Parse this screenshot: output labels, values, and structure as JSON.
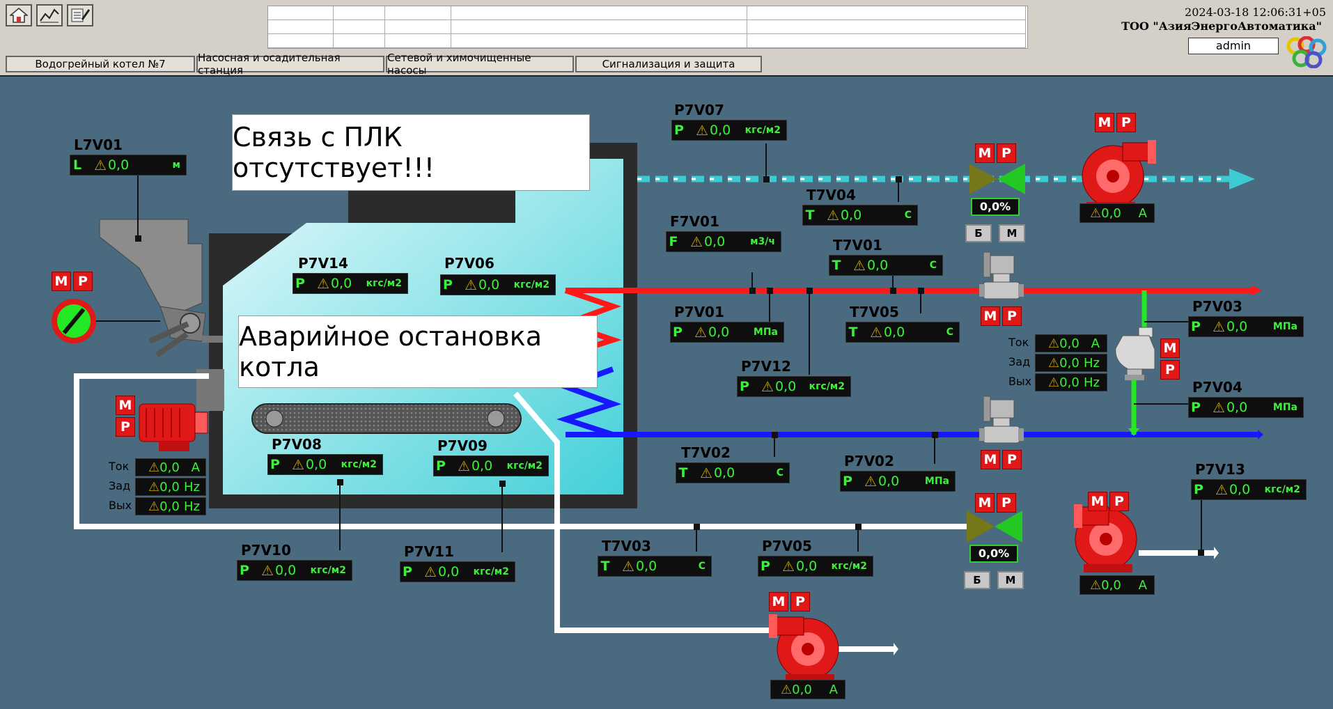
{
  "toolbar": {
    "home_icon": "home-icon",
    "trend_icon": "trend-chart-icon",
    "journal_icon": "journal-edit-icon"
  },
  "header": {
    "datetime": "2024-03-18 12:06:31+05",
    "company": "ТОО \"АзияЭнергоАвтоматика\"",
    "user": "admin"
  },
  "tabs": [
    {
      "label": "Водогрейный котел №7"
    },
    {
      "label": "Насосная и осадительная станция"
    },
    {
      "label": "Сетевой и химочищенные насосы"
    },
    {
      "label": "Сигнализация и защита"
    }
  ],
  "messages": {
    "plc": "Связь с ПЛК отсутствует!!!",
    "emergency": "Аварийное остановка котла"
  },
  "mr": {
    "m": "М",
    "r": "Р"
  },
  "bm": {
    "b": "Б",
    "m": "М"
  },
  "stat": {
    "tok": "Ток",
    "zad": "Зад",
    "vyh": "Вых"
  },
  "indicators": {
    "L7V01": {
      "tag": "L7V01",
      "letter": "L",
      "value": "0,0",
      "unit": "м"
    },
    "P7V07": {
      "tag": "P7V07",
      "letter": "P",
      "value": "0,0",
      "unit": "кгс/м2"
    },
    "T7V04": {
      "tag": "T7V04",
      "letter": "T",
      "value": "0,0",
      "unit": "С"
    },
    "F7V01": {
      "tag": "F7V01",
      "letter": "F",
      "value": "0,0",
      "unit": "м3/ч"
    },
    "T7V01": {
      "tag": "T7V01",
      "letter": "T",
      "value": "0,0",
      "unit": "С"
    },
    "P7V14": {
      "tag": "P7V14",
      "letter": "P",
      "value": "0,0",
      "unit": "кгс/м2"
    },
    "P7V06": {
      "tag": "P7V06",
      "letter": "P",
      "value": "0,0",
      "unit": "кгс/м2"
    },
    "P7V01": {
      "tag": "P7V01",
      "letter": "P",
      "value": "0,0",
      "unit": "МПа"
    },
    "T7V05": {
      "tag": "T7V05",
      "letter": "T",
      "value": "0,0",
      "unit": "С"
    },
    "P7V03": {
      "tag": "P7V03",
      "letter": "P",
      "value": "0,0",
      "unit": "МПа"
    },
    "P7V12": {
      "tag": "P7V12",
      "letter": "P",
      "value": "0,0",
      "unit": "кгс/м2"
    },
    "P7V04": {
      "tag": "P7V04",
      "letter": "P",
      "value": "0,0",
      "unit": "МПа"
    },
    "P7V08": {
      "tag": "P7V08",
      "letter": "P",
      "value": "0,0",
      "unit": "кгс/м2"
    },
    "P7V09": {
      "tag": "P7V09",
      "letter": "P",
      "value": "0,0",
      "unit": "кгс/м2"
    },
    "T7V02": {
      "tag": "T7V02",
      "letter": "T",
      "value": "0,0",
      "unit": "С"
    },
    "P7V02": {
      "tag": "P7V02",
      "letter": "P",
      "value": "0,0",
      "unit": "МПа"
    },
    "P7V13": {
      "tag": "P7V13",
      "letter": "P",
      "value": "0,0",
      "unit": "кгс/м2"
    },
    "P7V10": {
      "tag": "P7V10",
      "letter": "P",
      "value": "0,0",
      "unit": "кгс/м2"
    },
    "P7V11": {
      "tag": "P7V11",
      "letter": "P",
      "value": "0,0",
      "unit": "кгс/м2"
    },
    "T7V03": {
      "tag": "T7V03",
      "letter": "T",
      "value": "0,0",
      "unit": "С"
    },
    "P7V05": {
      "tag": "P7V05",
      "letter": "P",
      "value": "0,0",
      "unit": "кгс/м2"
    }
  },
  "valves": {
    "top": {
      "percent": "0,0%"
    },
    "bottom": {
      "percent": "0,0%"
    }
  },
  "amps": {
    "pump_top": {
      "value": "0,0",
      "unit": "А"
    },
    "pump_right": {
      "value": "0,0",
      "unit": "А"
    },
    "pump_bottom": {
      "value": "0,0",
      "unit": "А"
    }
  },
  "drive_left": {
    "tok": {
      "value": "0,0",
      "unit": "А"
    },
    "zad": {
      "value": "0,0",
      "unit": "Hz"
    },
    "vyh": {
      "value": "0,0",
      "unit": "Hz"
    }
  },
  "drive_right": {
    "tok": {
      "value": "0,0",
      "unit": "А"
    },
    "zad": {
      "value": "0,0",
      "unit": "Hz"
    },
    "vyh": {
      "value": "0,0",
      "unit": "Hz"
    }
  }
}
